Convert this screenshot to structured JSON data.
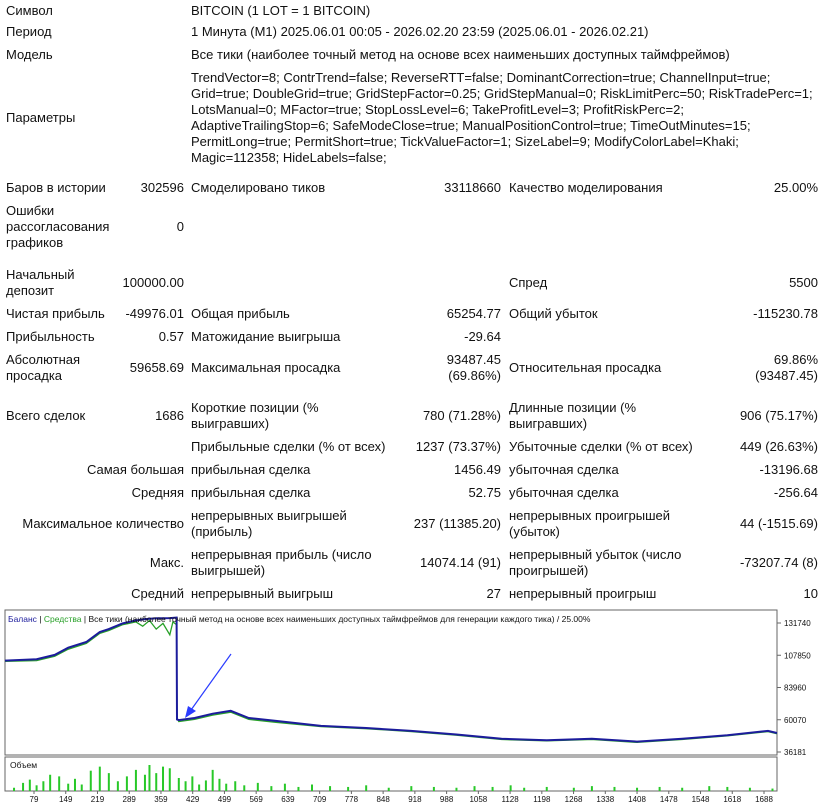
{
  "report": {
    "symbol": {
      "label": "Символ",
      "value": "BITCOIN (1 LOT = 1 BITCOIN)"
    },
    "period": {
      "label": "Период",
      "value": "1 Минута (M1) 2025.06.01 00:05 - 2026.02.20 23:59 (2025.06.01 - 2026.02.21)"
    },
    "model": {
      "label": "Модель",
      "value": "Все тики (наиболее точный метод на основе всех наименьших доступных таймфреймов)"
    },
    "params": {
      "label": "Параметры",
      "lines": [
        "TrendVector=8; ContrTrend=false; ReverseRTT=false; DominantCorrection=true; ChannelInput=true;",
        "Grid=true; DoubleGrid=true; GridStepFactor=0.25; GridStepManual=0; RiskLimitPerc=50; RiskTradePerc=1;",
        "LotsManual=0; MFactor=true; StopLossLevel=6; TakeProfitLevel=3; ProfitRiskPerc=2;",
        "AdaptiveTrailingStop=6; SafeModeClose=true; ManualPositionControl=true; TimeOutMinutes=15;",
        "PermitLong=true; PermitShort=true; TickValueFactor=1; SizeLabel=9; ModifyColorLabel=Khaki;",
        "Magic=112358; HideLabels=false;"
      ]
    },
    "bars": {
      "label": "Баров в истории",
      "value": "302596"
    },
    "ticks": {
      "label": "Смоделировано тиков",
      "value": "33118660"
    },
    "quality": {
      "label": "Качество моделирования",
      "value": "25.00%"
    },
    "errors": {
      "label1": "Ошибки",
      "label2": "рассогласования",
      "label3": "графиков",
      "value": "0"
    },
    "deposit": {
      "label1": "Начальный",
      "label2": "депозит",
      "value": "100000.00"
    },
    "spread": {
      "label": "Спред",
      "value": "5500"
    },
    "net_profit": {
      "label": "Чистая прибыль",
      "value": "-49976.01"
    },
    "gross_profit": {
      "label": "Общая прибыль",
      "value": "65254.77"
    },
    "gross_loss": {
      "label": "Общий убыток",
      "value": "-115230.78"
    },
    "profit_factor": {
      "label": "Прибыльность",
      "value": "0.57"
    },
    "expected_payoff": {
      "label": "Матожидание выигрыша",
      "value": "-29.64"
    },
    "abs_drawdown": {
      "label1": "Абсолютная",
      "label2": "просадка",
      "value": "59658.69"
    },
    "max_drawdown": {
      "label": "Максимальная просадка",
      "value1": "93487.45",
      "value2": "(69.86%)"
    },
    "rel_drawdown": {
      "label": "Относительная просадка",
      "value1": "69.86%",
      "value2": "(93487.45)"
    },
    "total_trades": {
      "label": "Всего сделок",
      "value": "1686"
    },
    "short_pos": {
      "label1": "Короткие позиции (%",
      "label2": "выигравших)",
      "value": "780 (71.28%)"
    },
    "long_pos": {
      "label1": "Длинные позиции (%",
      "label2": "выигравших)",
      "value": "906 (75.17%)"
    },
    "profit_trades": {
      "label": "Прибыльные сделки (% от всех)",
      "value": "1237 (73.37%)"
    },
    "loss_trades": {
      "label": "Убыточные сделки (% от всех)",
      "value": "449 (26.63%)"
    },
    "largest": {
      "label": "Самая большая",
      "profit_label": "прибыльная сделка",
      "profit_value": "1456.49",
      "loss_label": "убыточная сделка",
      "loss_value": "-13196.68"
    },
    "average": {
      "label": "Средняя",
      "profit_label": "прибыльная сделка",
      "profit_value": "52.75",
      "loss_label": "убыточная сделка",
      "loss_value": "-256.64"
    },
    "max_consec": {
      "label": "Максимальное количество",
      "win_label1": "непрерывных выигрышей",
      "win_label2": "(прибыль)",
      "win_value": "237 (11385.20)",
      "loss_label1": "непрерывных проигрышей",
      "loss_label2": "(убыток)",
      "loss_value": "44 (-1515.69)"
    },
    "max_consec2": {
      "label": "Макс.",
      "win_label1": "непрерывная прибыль (число",
      "win_label2": "выигрышей)",
      "win_value": "14074.14 (91)",
      "loss_label1": "непрерывный убыток (число",
      "loss_label2": "проигрышей)",
      "loss_value": "-73207.74 (8)"
    },
    "avg_consec": {
      "label": "Средний",
      "win_label": "непрерывный выигрыш",
      "win_value": "27",
      "loss_label": "непрерывный проигрыш",
      "loss_value": "10"
    }
  },
  "chart_data": {
    "type": "line",
    "header": {
      "balance": "Баланс",
      "sep1": " | ",
      "equity": "Средства",
      "sep2": " | ",
      "rest": "Все тики (наиболее точный метод на основе всех наименьших доступных таймфреймов для генерации каждого тика) / 25.00%"
    },
    "volume_label": "Объем",
    "colors": {
      "balance": "#1c1c9c",
      "equity": "#28a028",
      "volume": "#28c828",
      "arrow": "#2a3cff",
      "grid": "#c8c8c8"
    },
    "x_ticks": [
      "79",
      "149",
      "219",
      "289",
      "359",
      "429",
      "499",
      "569",
      "639",
      "709",
      "778",
      "848",
      "918",
      "988",
      "1058",
      "1128",
      "1198",
      "1268",
      "1338",
      "1408",
      "1478",
      "1548",
      "1618",
      "1688"
    ],
    "x_range": [
      0,
      1710
    ],
    "y_ticks": [
      "131740",
      "107850",
      "83960",
      "60070",
      "36181"
    ],
    "y_range": [
      36181,
      131740
    ],
    "series": [
      {
        "name": "Баланс",
        "x": [
          0,
          70,
          110,
          140,
          180,
          210,
          230,
          260,
          290,
          310,
          335,
          365,
          380,
          381,
          385,
          420,
          460,
          500,
          540,
          600,
          700,
          800,
          900,
          1000,
          1100,
          1200,
          1300,
          1400,
          1500,
          1600,
          1690,
          1710
        ],
        "y": [
          102000,
          103000,
          106000,
          111000,
          115000,
          122000,
          124000,
          128000,
          130000,
          131000,
          131500,
          131700,
          132000,
          61000,
          60500,
          62000,
          65000,
          67000,
          62000,
          60000,
          56500,
          55000,
          53000,
          50500,
          47500,
          46500,
          47500,
          45500,
          47500,
          50000,
          53000,
          51500
        ]
      },
      {
        "name": "Средства",
        "x": [
          0,
          70,
          110,
          140,
          180,
          210,
          230,
          260,
          290,
          305,
          320,
          335,
          350,
          365,
          372,
          380,
          381,
          385,
          420,
          460,
          500,
          540,
          600,
          700,
          800,
          900,
          1000,
          1100,
          1200,
          1300,
          1400,
          1500,
          1600,
          1690,
          1710
        ],
        "y": [
          101500,
          102000,
          105000,
          110000,
          114000,
          121000,
          123000,
          127000,
          129000,
          126000,
          130000,
          124000,
          128000,
          120000,
          129000,
          127000,
          62000,
          59500,
          61000,
          64000,
          66000,
          61000,
          59000,
          56000,
          54500,
          52500,
          50000,
          47000,
          46000,
          47000,
          45000,
          47000,
          49500,
          52500,
          51000
        ]
      }
    ],
    "volume": {
      "x": [
        20,
        40,
        55,
        70,
        85,
        100,
        120,
        140,
        155,
        170,
        190,
        210,
        230,
        250,
        270,
        290,
        310,
        320,
        335,
        350,
        365,
        385,
        400,
        415,
        430,
        445,
        460,
        475,
        490,
        510,
        530,
        560,
        590,
        620,
        650,
        680,
        720,
        760,
        800,
        850,
        900,
        950,
        1000,
        1040,
        1080,
        1120,
        1150,
        1200,
        1260,
        1300,
        1350,
        1400,
        1450,
        1500,
        1560,
        1600,
        1650,
        1700
      ],
      "y": [
        4,
        10,
        14,
        7,
        12,
        20,
        18,
        9,
        15,
        8,
        25,
        30,
        22,
        12,
        18,
        26,
        20,
        32,
        22,
        30,
        28,
        16,
        12,
        18,
        8,
        13,
        26,
        15,
        9,
        12,
        7,
        10,
        6,
        9,
        5,
        8,
        6,
        5,
        7,
        4,
        6,
        5,
        4,
        6,
        5,
        7,
        4,
        5,
        4,
        6,
        5,
        4,
        5,
        4,
        6,
        5,
        4,
        3
      ]
    }
  }
}
